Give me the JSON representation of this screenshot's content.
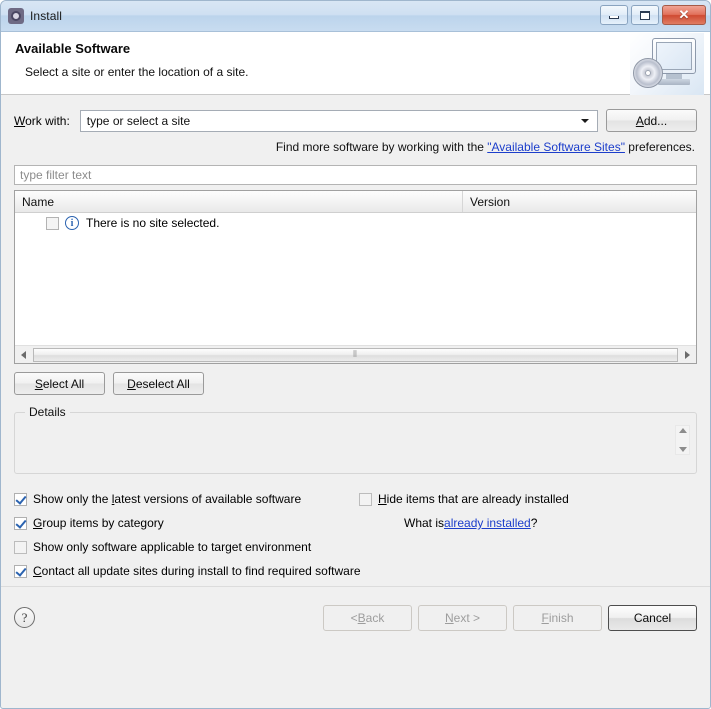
{
  "window": {
    "title": "Install",
    "icon": "install-gear-icon",
    "controls": {
      "minimize": "minimize-icon",
      "maximize": "maximize-icon",
      "close": "✕"
    }
  },
  "header": {
    "title": "Available Software",
    "subtitle": "Select a site or enter the location of a site.",
    "art": "computer-cd-icon"
  },
  "work_with": {
    "label_mnemonic": "W",
    "label_rest": "ork with:",
    "value": "type or select a site",
    "placeholder": "type or select a site",
    "add_button": {
      "mnemonic": "A",
      "rest": "dd..."
    }
  },
  "hint": {
    "prefix": "Find more software by working with the ",
    "link": "\"Available Software Sites\"",
    "suffix": " preferences."
  },
  "filter": {
    "placeholder": "type filter text",
    "value": ""
  },
  "tree": {
    "columns": [
      "Name",
      "Version"
    ],
    "rows": [
      {
        "checked": false,
        "icon": "info-icon",
        "name": "There is no site selected.",
        "version": ""
      }
    ],
    "hscroll": {
      "left_arrow": "scroll-left-icon",
      "right_arrow": "scroll-right-icon",
      "grip": "⦀"
    }
  },
  "selection_buttons": {
    "select_all": {
      "mnemonic": "S",
      "rest": "elect All"
    },
    "deselect_all": {
      "mnemonic": "D",
      "rest": "eselect All"
    }
  },
  "details": {
    "legend": "Details",
    "content": ""
  },
  "options": {
    "left": [
      {
        "checked": true,
        "pre": "Show only the ",
        "mnemonic": "l",
        "post": "atest versions of available software"
      },
      {
        "checked": true,
        "pre": "",
        "mnemonic": "G",
        "post": "roup items by category"
      },
      {
        "checked": false,
        "pre": "",
        "mnemonic": "",
        "post": "Show only software applicable to target environment"
      },
      {
        "checked": true,
        "pre": "",
        "mnemonic": "C",
        "post": "ontact all update sites during install to find required software"
      }
    ],
    "right": [
      {
        "checked": false,
        "pre": "",
        "mnemonic": "H",
        "post": "ide items that are already installed"
      }
    ],
    "what_is": {
      "prefix": "What is ",
      "link": "already installed",
      "suffix": "?"
    }
  },
  "footer": {
    "help": "?",
    "buttons": [
      {
        "label": "< Back",
        "mnemonic_pre": "< ",
        "mnemonic": "B",
        "mnemonic_post": "ack",
        "disabled": true
      },
      {
        "label": "Next >",
        "mnemonic_pre": "",
        "mnemonic": "N",
        "mnemonic_post": "ext >",
        "disabled": true
      },
      {
        "label": "Finish",
        "mnemonic_pre": "",
        "mnemonic": "F",
        "mnemonic_post": "inish",
        "disabled": true
      },
      {
        "label": "Cancel",
        "mnemonic_pre": "",
        "mnemonic": "",
        "mnemonic_post": "Cancel",
        "disabled": false
      }
    ]
  },
  "colors": {
    "titlebar": "#cfe0f2",
    "body": "#f0f0f0",
    "link": "#1c3ecb",
    "close_button": "#cf4a31",
    "info_blue": "#2b63b0"
  }
}
